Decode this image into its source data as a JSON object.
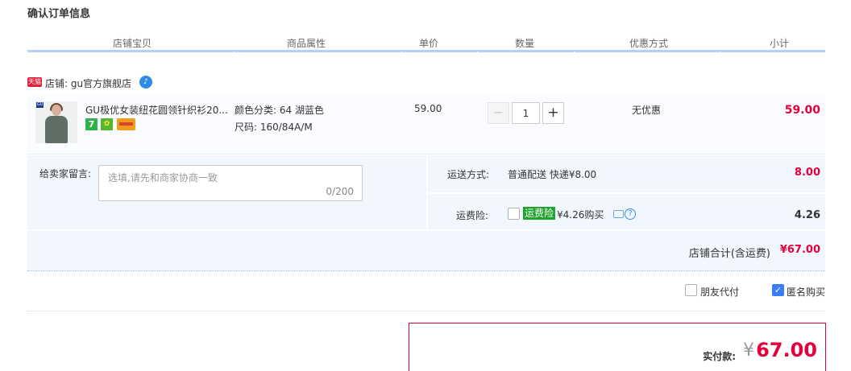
{
  "page": {
    "title": "确认订单信息"
  },
  "columns": [
    "店铺宝贝",
    "商品属性",
    "单价",
    "数量",
    "优惠方式",
    "小计"
  ],
  "shop": {
    "badge": "天猫",
    "label": "店铺: gu官方旗舰店",
    "chat_icon": "wangwang-chat-icon"
  },
  "item": {
    "title": "GU极优女装纽花圆领针织衫20...",
    "attr_color": "颜色分类: 64 湖蓝色",
    "attr_size": "尺码: 160/84A/M",
    "unit_price": "59.00",
    "quantity": "1",
    "minus_label": "−",
    "plus_label": "+",
    "discount": "无优惠",
    "subtotal": "59.00",
    "badges": [
      "7",
      "shield",
      "card"
    ]
  },
  "message": {
    "label": "给卖家留言:",
    "placeholder": "选填,请先和商家协商一致",
    "count": "0/200"
  },
  "shipping": {
    "label": "运送方式:",
    "value": "普通配送 快递¥8.00",
    "fee": "8.00"
  },
  "insurance": {
    "label": "运费险:",
    "tag": "运费险",
    "price": "¥4.26购买",
    "fee": "4.26"
  },
  "shop_total": {
    "label": "店铺合计(含运费)",
    "value": "¥67.00"
  },
  "options": {
    "friend_pay": "朋友代付",
    "anonymous": "匿名购买",
    "anonymous_checked": true
  },
  "payment": {
    "label": "实付款:",
    "currency": "¥",
    "value": "67.00"
  },
  "colors": {
    "accent_red": "#e4003b",
    "header_line": "#b2d1ff",
    "panel_bg": "#f2f7ff"
  }
}
